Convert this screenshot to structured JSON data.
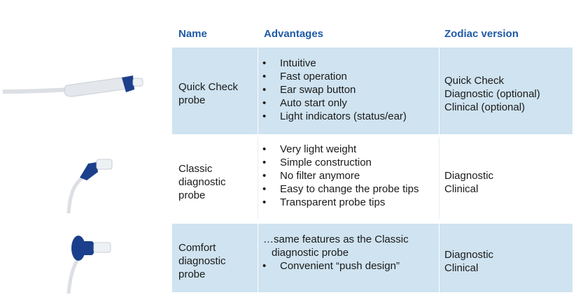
{
  "headers": {
    "name": "Name",
    "advantages": "Advantages",
    "zodiac": "Zodiac version"
  },
  "rows": [
    {
      "name_lines": [
        "Quick Check",
        "probe"
      ],
      "advantages": [
        "Intuitive",
        "Fast operation",
        "Ear swap button",
        "Auto start only",
        "Light indicators (status/ear)"
      ],
      "zodiac_lines": [
        "Quick Check",
        "Diagnostic (optional)",
        "Clinical (optional)"
      ]
    },
    {
      "name_lines": [
        "Classic",
        "diagnostic",
        "probe"
      ],
      "advantages": [
        "Very light weight",
        "Simple construction",
        "No filter anymore",
        "Easy to change the probe tips",
        "Transparent probe tips"
      ],
      "zodiac_lines": [
        "Diagnostic",
        "Clinical"
      ]
    },
    {
      "name_lines": [
        "Comfort",
        "diagnostic",
        "probe"
      ],
      "advantages_intro": [
        "…same features as the Classic",
        "diagnostic probe"
      ],
      "advantages": [
        "Convenient “push design”"
      ],
      "zodiac_lines": [
        "Diagnostic",
        "Clinical"
      ]
    }
  ],
  "colors": {
    "header_text": "#1f5aa6",
    "row_bg": "#cfe3f0",
    "probe_accent": "#1c3f8c"
  }
}
